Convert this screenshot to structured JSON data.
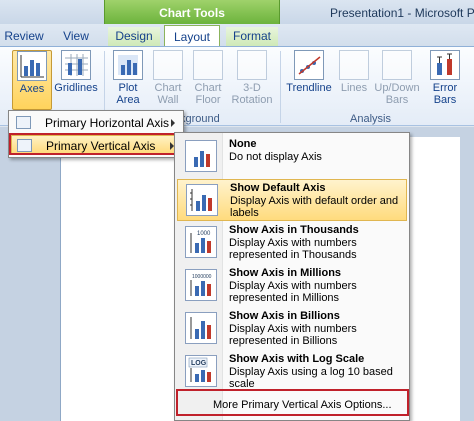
{
  "window": {
    "doc_title": "Presentation1 - Microsoft P"
  },
  "context": {
    "label": "Chart Tools"
  },
  "tabs": [
    {
      "label": "Review"
    },
    {
      "label": "View"
    },
    {
      "label": "Design"
    },
    {
      "label": "Layout"
    },
    {
      "label": "Format"
    }
  ],
  "ribbon": {
    "axes": "Axes",
    "gridlines": "Gridlines",
    "plot_area_1": "Plot",
    "plot_area_2": "Area",
    "chart_wall_1": "Chart",
    "chart_wall_2": "Wall",
    "chart_floor_1": "Chart",
    "chart_floor_2": "Floor",
    "rotation_1": "3-D",
    "rotation_2": "Rotation",
    "trendline": "Trendline",
    "lines": "Lines",
    "updown_1": "Up/Down",
    "updown_2": "Bars",
    "error_1": "Error",
    "error_2": "Bars",
    "group_background": "kground",
    "group_analysis": "Analysis"
  },
  "axes_menu": {
    "horizontal": "Primary Horizontal Axis",
    "vertical": "Primary Vertical Axis"
  },
  "vertical_menu": {
    "options": [
      {
        "title": "None",
        "desc": "Do not display Axis"
      },
      {
        "title": "Show Default Axis",
        "desc": "Display Axis with default order and labels"
      },
      {
        "title": "Show Axis in Thousands",
        "desc": "Display Axis with numbers represented in Thousands"
      },
      {
        "title": "Show Axis in Millions",
        "desc": "Display Axis with numbers represented in Millions"
      },
      {
        "title": "Show Axis in Billions",
        "desc": "Display Axis with numbers represented in Billions"
      },
      {
        "title": "Show Axis with Log Scale",
        "desc": "Display Axis using a log 10 based scale"
      }
    ],
    "icon_labels": [
      "1000",
      "1000000",
      "LOG"
    ],
    "more": "More Primary Vertical Axis Options..."
  },
  "colors": {
    "highlight": "#ffd979",
    "callout": "#c0212b",
    "context": "#6cb33c"
  }
}
